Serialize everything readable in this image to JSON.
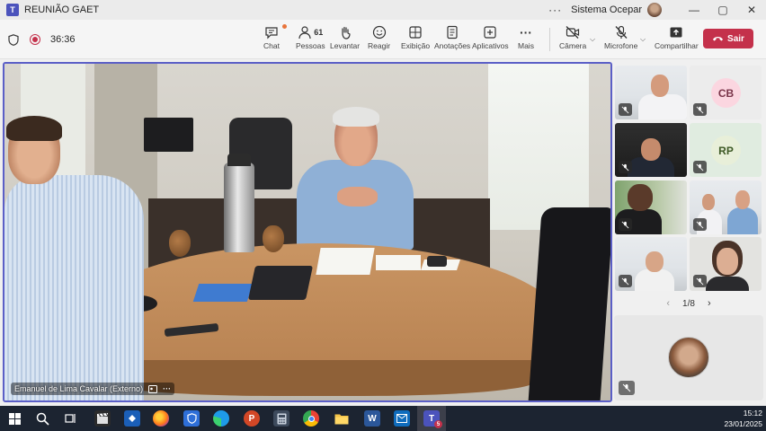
{
  "window": {
    "title": "REUNIÃO GAET",
    "more": "···",
    "org": "Sistema Ocepar",
    "controls": {
      "minimize": "—",
      "maximize": "▢",
      "close": "✕"
    }
  },
  "toolbar": {
    "timer": "36:36",
    "chat_label": "Chat",
    "people_label": "Pessoas",
    "people_count": "61",
    "raise_label": "Levantar",
    "react_label": "Reagir",
    "view_label": "Exibição",
    "notes_label": "Anotações",
    "apps_label": "Aplicativos",
    "more_label": "Mais",
    "camera_label": "Câmera",
    "mic_label": "Microfone",
    "share_label": "Compartilhar",
    "leave_label": "Sair"
  },
  "main_video": {
    "speaker_name": "Emanuel de Lima Cavalar (Externo)",
    "more": "···"
  },
  "tiles": [
    {
      "type": "video"
    },
    {
      "type": "initials",
      "initials": "CB",
      "bg": "#ececec",
      "avatar_bg": "#fbd6e0",
      "avatar_fg": "#7a3449"
    },
    {
      "type": "video"
    },
    {
      "type": "initials",
      "initials": "RP",
      "bg": "#e0ece0",
      "avatar_bg": "#e8efd9",
      "avatar_fg": "#3e5a26"
    },
    {
      "type": "video"
    },
    {
      "type": "video"
    },
    {
      "type": "video"
    },
    {
      "type": "video"
    }
  ],
  "pager": {
    "prev": "‹",
    "text": "1/8",
    "next": "›"
  },
  "taskbar": {
    "time": "15:12",
    "date": "23/01/2025",
    "icons": [
      "windows-icon",
      "search-icon",
      "task-view-icon",
      "clapperboard-icon",
      "app-blue-icon",
      "firefox-icon",
      "shield-app-icon",
      "edge-icon",
      "powerpoint-icon",
      "calculator-icon",
      "chrome-icon",
      "file-explorer-icon",
      "word-icon",
      "outlook-icon",
      "teams-icon"
    ],
    "teams_badge": "5"
  },
  "colors": {
    "accent": "#5b5fc7",
    "leave": "#c4314b",
    "taskbar": "#1c2431"
  }
}
